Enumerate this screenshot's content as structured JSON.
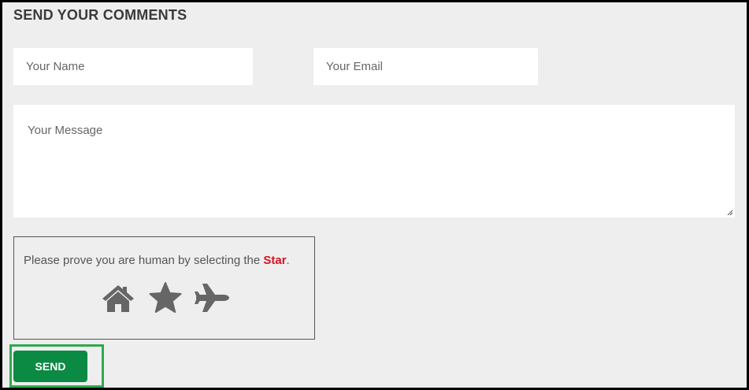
{
  "form": {
    "title": "SEND YOUR COMMENTS",
    "name_placeholder": "Your Name",
    "email_placeholder": "Your Email",
    "message_placeholder": "Your Message"
  },
  "captcha": {
    "prompt_prefix": "Please prove you are human by selecting the ",
    "prompt_target": "Star",
    "prompt_suffix": ".",
    "target_color": "#d9101f",
    "options": [
      {
        "icon": "home-icon"
      },
      {
        "icon": "star-icon"
      },
      {
        "icon": "plane-icon"
      }
    ],
    "icon_color": "#666666"
  },
  "actions": {
    "send_label": "SEND",
    "send_color": "#0b8a43",
    "highlight_color": "#2fa84f"
  }
}
